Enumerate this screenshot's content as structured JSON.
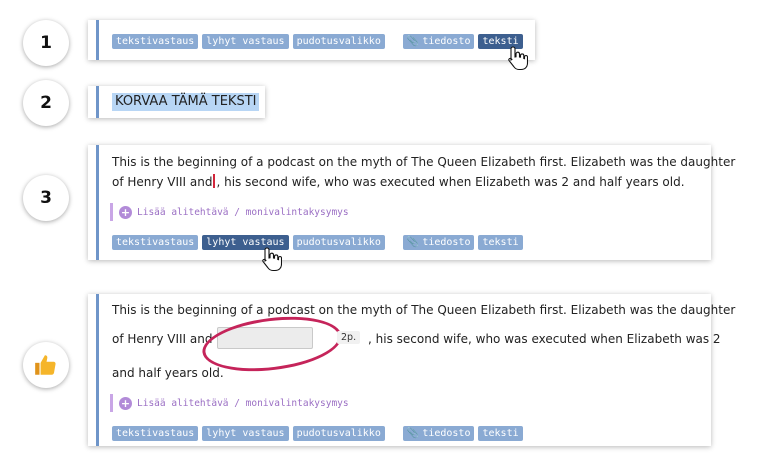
{
  "steps": {
    "s1": "1",
    "s2": "2",
    "s3": "3",
    "s4_icon": "thumbs-up-icon"
  },
  "toolbar": {
    "textfield": "tekstivastaus",
    "short_answer": "lyhyt vastaus",
    "dropdown": "pudotusvalikko",
    "file": "tiedosto",
    "text": "teksti",
    "clip_icon": "paperclip-icon"
  },
  "replace_text": "KORVAA TÄMÄ TEKSTI",
  "paragraph": {
    "line1": "This is the beginning of a podcast on the myth of The Queen Elizabeth first. Elizabeth was the daughter",
    "line2_before": "of Henry VIII and",
    "line2_after": " his second wife, who was executed when Elizabeth was 2 and half years old.",
    "line2_after_caret": ", his second wife, who was executed when Elizabeth was 2 and half years old."
  },
  "paragraph4": {
    "line1": "This is the beginning of a podcast on the myth of The Queen Elizabeth first. Elizabeth was the daughter",
    "line2_before": "of Henry VIII and",
    "points": "2p.",
    "line2_after": ", his second wife, who was executed when Elizabeth was 2",
    "line3": "and half years old."
  },
  "subtask": "Lisää alitehtävä / monivalintakysymys",
  "colors": {
    "accent": "#3d5f8f",
    "tag": "#8aaad3",
    "highlight": "#c5245a",
    "subtask": "#9b6fc4"
  }
}
